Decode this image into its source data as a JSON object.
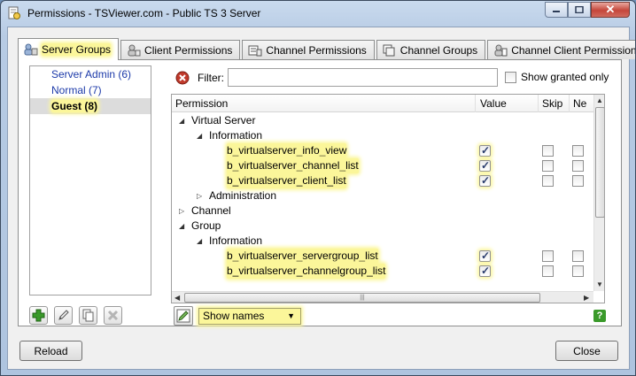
{
  "window": {
    "title": "Permissions - TSViewer.com - Public TS 3 Server"
  },
  "tabs": [
    {
      "label": "Server Groups",
      "active": true,
      "highlighted": true
    },
    {
      "label": "Client Permissions"
    },
    {
      "label": "Channel Permissions"
    },
    {
      "label": "Channel Groups"
    },
    {
      "label": "Channel Client Permissions"
    }
  ],
  "groups": [
    {
      "label": "Server Admin (6)"
    },
    {
      "label": "Normal (7)"
    },
    {
      "label": "Guest (8)",
      "selected": true
    }
  ],
  "filter": {
    "label": "Filter:",
    "value": "",
    "show_granted_label": "Show granted only",
    "show_granted_checked": false
  },
  "columns": {
    "permission": "Permission",
    "value": "Value",
    "skip": "Skip",
    "negate": "Ne"
  },
  "tree": [
    {
      "label": "Virtual Server",
      "level": 0,
      "expanded": true
    },
    {
      "label": "Information",
      "level": 1,
      "expanded": true
    },
    {
      "label": "b_virtualserver_info_view",
      "level": 2,
      "value": true,
      "skip": false,
      "negate": false
    },
    {
      "label": "b_virtualserver_channel_list",
      "level": 2,
      "value": true,
      "skip": false,
      "negate": false
    },
    {
      "label": "b_virtualserver_client_list",
      "level": 2,
      "value": true,
      "skip": false,
      "negate": false
    },
    {
      "label": "Administration",
      "level": 1,
      "expanded": false
    },
    {
      "label": "Channel",
      "level": 0,
      "expanded": false
    },
    {
      "label": "Group",
      "level": 0,
      "expanded": true
    },
    {
      "label": "Information",
      "level": 1,
      "expanded": true
    },
    {
      "label": "b_virtualserver_servergroup_list",
      "level": 2,
      "value": true,
      "skip": false,
      "negate": false
    },
    {
      "label": "b_virtualserver_channelgroup_list",
      "level": 2,
      "value": true,
      "skip": false,
      "negate": false
    }
  ],
  "display_mode": {
    "selected": "Show names"
  },
  "buttons": {
    "reload": "Reload",
    "close": "Close"
  },
  "colors": {
    "highlight": "#fbf69a",
    "link": "#1c3aa9",
    "add_green": "#3a9a2a"
  }
}
